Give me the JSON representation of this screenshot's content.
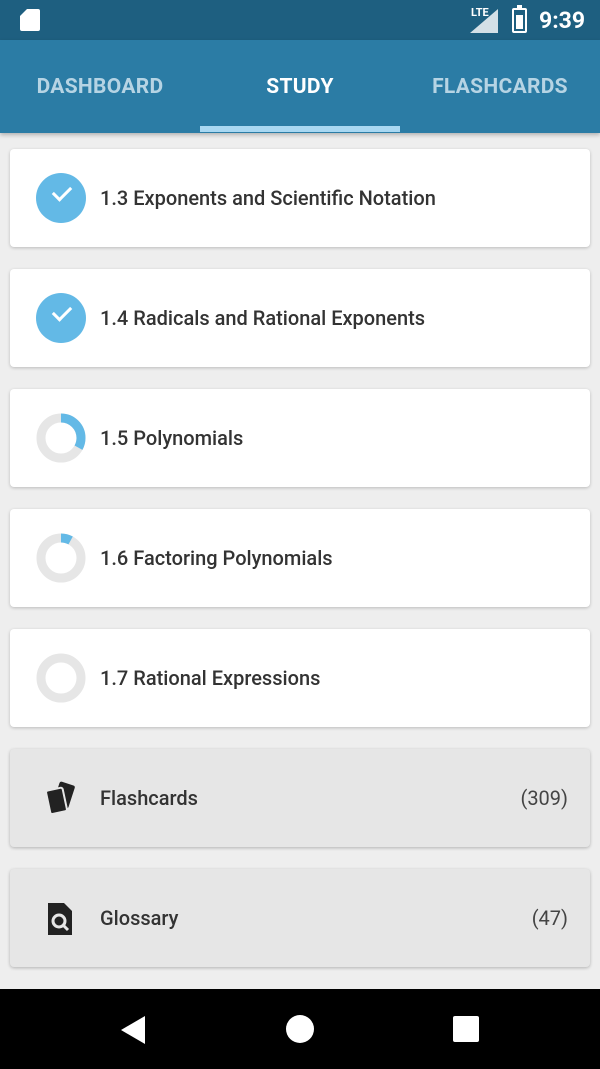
{
  "status_bar": {
    "time": "9:39",
    "network": "LTE",
    "icons": [
      "sim-card-icon",
      "signal-icon",
      "battery-icon"
    ]
  },
  "tabs": [
    {
      "label": "DASHBOARD",
      "active": false
    },
    {
      "label": "STUDY",
      "active": true
    },
    {
      "label": "FLASHCARDS",
      "active": false
    }
  ],
  "sections": [
    {
      "label": "1.3 Exponents and Scientific Notation",
      "status": "complete"
    },
    {
      "label": "1.4 Radicals and Rational Exponents",
      "status": "complete"
    },
    {
      "label": "1.5 Polynomials",
      "status": "in-progress",
      "progress": 0.33
    },
    {
      "label": "1.6 Factoring Polynomials",
      "status": "in-progress",
      "progress": 0.08
    },
    {
      "label": "1.7 Rational Expressions",
      "status": "not-started",
      "progress": 0
    }
  ],
  "resources": [
    {
      "label": "Flashcards",
      "count": "(309)",
      "icon": "flashcards-icon"
    },
    {
      "label": "Glossary",
      "count": "(47)",
      "icon": "glossary-icon"
    }
  ],
  "colors": {
    "appbar": "#2b7ca5",
    "statusbar": "#1e5f80",
    "accent": "#63b9e6",
    "track": "#e6e6e6"
  },
  "navbar": {
    "icons": [
      "back-icon",
      "home-icon",
      "recents-icon"
    ]
  }
}
